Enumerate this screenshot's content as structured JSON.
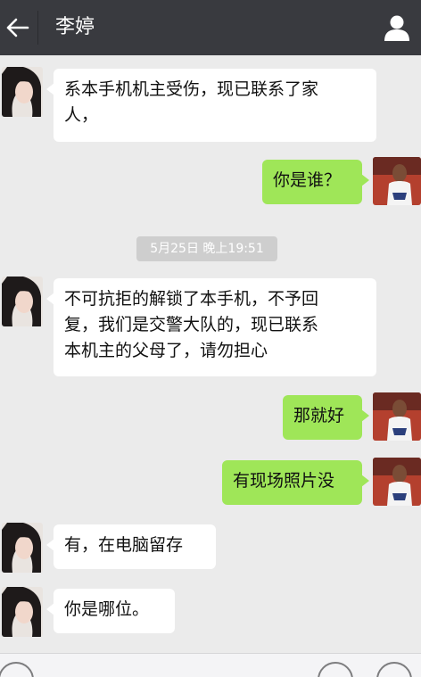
{
  "header": {
    "title": "李婷",
    "back_icon": "back-arrow-icon",
    "profile_icon": "person-icon"
  },
  "colors": {
    "header_bg": "#393a3f",
    "chat_bg": "#ebebeb",
    "incoming_bubble": "#ffffff",
    "outgoing_bubble": "#9fe658"
  },
  "messages": [
    {
      "side": "in",
      "line1": "系本手机机主受伤，现已联系了家",
      "line2": "人，",
      "line3": ""
    },
    {
      "side": "out",
      "line1": "你是谁？"
    },
    {
      "side": "in",
      "line1": "不可抗拒的解锁了本手机，不予回",
      "line2": "复，我们是交警大队的，现已联系",
      "line3": "本机主的父母了，请勿担心"
    },
    {
      "side": "out",
      "line1": "那就好"
    },
    {
      "side": "out",
      "line1": "有现场照片没"
    },
    {
      "side": "in",
      "line1": "有，在电脑留存"
    },
    {
      "side": "in",
      "line1": "你是哪位。"
    }
  ],
  "timestamp": "5月25日 晚上19:51",
  "input_bar": {
    "voice_icon": "voice-icon",
    "emoji_icon": "emoji-icon",
    "plus_icon": "plus-icon"
  }
}
